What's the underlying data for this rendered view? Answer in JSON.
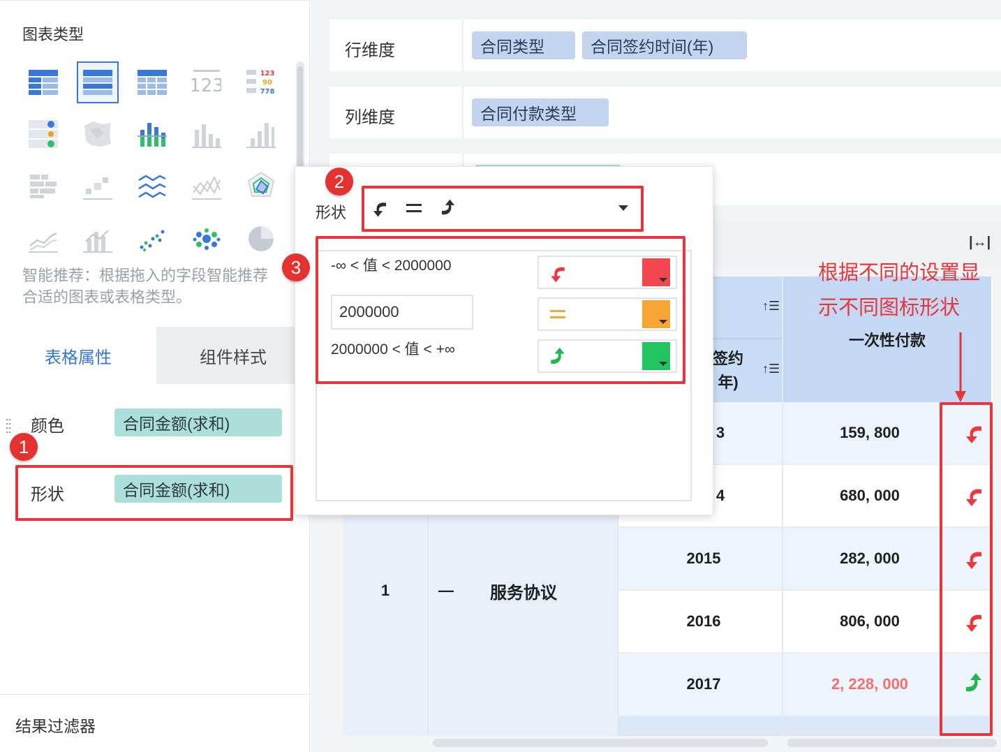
{
  "left_panel": {
    "chart_type_title": "图表类型",
    "smart_hint": "智能推荐：根据拖入的字段智能推荐合适的图表或表格类型。",
    "tabs": [
      "表格属性",
      "组件样式"
    ],
    "attributes": [
      {
        "label": "颜色",
        "field": "合同金额(求和)"
      },
      {
        "label": "形状",
        "field": "合同金额(求和)"
      }
    ],
    "result_filter": "结果过滤器",
    "chart_type_icons": [
      "table-icon",
      "cross-table-icon",
      "detail-table-icon",
      "number-icon",
      "multi-number-icon",
      "progress-icon",
      "map-icon",
      "stacked-bar-icon",
      "bar-icon",
      "column-icon",
      "grouped-bar-icon",
      "scatter-small-icon",
      "area-line-icon",
      "line-icon",
      "radar-icon",
      "stacked-line-icon",
      "combo-icon",
      "scatter-icon",
      "bubble-icon",
      "pie-icon"
    ]
  },
  "dimensions": {
    "row_label": "行维度",
    "row_fields": [
      "合同类型",
      "合同签约时间(年)"
    ],
    "col_label": "列维度",
    "col_fields": [
      "合同付款类型"
    ]
  },
  "popup": {
    "shape_label": "形状",
    "shape_set": "arrow-shapes",
    "conditions": [
      {
        "text": "-∞ < 值 < 2000000",
        "icon": "curved-arrow-down-left",
        "color": "#f34750"
      },
      {
        "text": "2000000",
        "icon": "equal",
        "color": "#f7a535"
      },
      {
        "text": "2000000 < 值 < +∞",
        "icon": "curved-arrow-up",
        "color": "#21c45e"
      }
    ]
  },
  "table": {
    "header_col2_top": "签约",
    "header_col2_bottom": "年)",
    "header_col3": "一次性付款",
    "index": "1",
    "collapse_symbol": "—",
    "group_name": "服务协议",
    "rows": [
      {
        "year": "3",
        "value": "159, 800",
        "trend": "down",
        "highlight": false
      },
      {
        "year": "4",
        "value": "680, 000",
        "trend": "down",
        "highlight": false
      },
      {
        "year": "2015",
        "value": "282, 000",
        "trend": "down",
        "highlight": false
      },
      {
        "year": "2016",
        "value": "806, 000",
        "trend": "down",
        "highlight": false
      },
      {
        "year": "2017",
        "value": "2, 228, 000",
        "trend": "up",
        "highlight": true
      }
    ],
    "expand_icon": "|↔|"
  },
  "annotations": {
    "badges": [
      "1",
      "2",
      "3"
    ],
    "note": [
      "根据不同的设置显",
      "示不同图标形状"
    ]
  },
  "colors": {
    "accent": "#3476d6",
    "annotation_red": "#e5373b",
    "down_red": "#f0363c",
    "up_green": "#1fb84f",
    "highlight_value": "#f07070"
  }
}
